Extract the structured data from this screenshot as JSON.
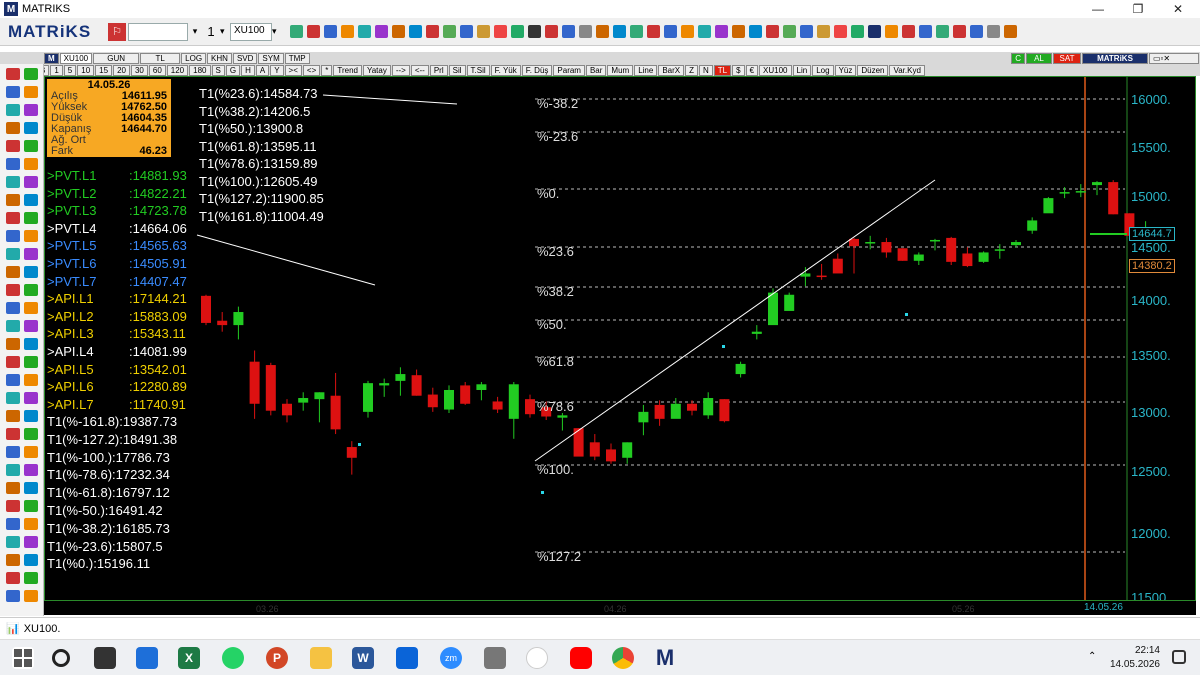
{
  "window": {
    "title": "MATRIKS",
    "brand": "MATRiKS"
  },
  "toolbar": {
    "combo_value": "",
    "count_value": "1",
    "symbol_input": "XU100"
  },
  "strip1": [
    "XU100",
    "GUN",
    "TL",
    "LOG",
    "KHN",
    "SVD",
    "SYM",
    "TMP"
  ],
  "strip1_right": {
    "c": "C",
    "al": "AL",
    "sat": "SAT",
    "brand": "MATRiKS"
  },
  "strip2": [
    "B",
    "1",
    "5",
    "10",
    "15",
    "20",
    "30",
    "60",
    "120",
    "180",
    "S",
    "G",
    "H",
    "A",
    "Y",
    "><",
    "<>",
    "*",
    "Trend",
    "Yatay",
    "-->",
    "<--",
    "Prl",
    "Sil",
    "T.Sil",
    "F. Yük",
    "F. Düş",
    "Param",
    "Bar",
    "Mum",
    "Line",
    "BarX",
    "Z",
    "N",
    "TL",
    "$",
    "€",
    "XU100",
    "Lin",
    "Log",
    "Yüz",
    "Düzen",
    "Var.Kyd"
  ],
  "info": {
    "date": "14.05.26",
    "rows": [
      [
        "Açılış",
        "14611.95"
      ],
      [
        "Yüksek",
        "14762.50"
      ],
      [
        "Düşük",
        "14604.35"
      ],
      [
        "Kapanış",
        "14644.70"
      ],
      [
        "Ağ. Ort",
        ""
      ],
      [
        "Fark",
        "46.23"
      ]
    ]
  },
  "levels": [
    {
      "label": ">PVT.L1",
      "value": ":14881.93",
      "color": "#22cc22"
    },
    {
      "label": ">PVT.L2",
      "value": ":14822.21",
      "color": "#22cc22"
    },
    {
      "label": ">PVT.L3",
      "value": ":14723.78",
      "color": "#22cc22"
    },
    {
      "label": ">PVT.L4",
      "value": ":14664.06",
      "color": "#ffffff"
    },
    {
      "label": ">PVT.L5",
      "value": ":14565.63",
      "color": "#3a8cff"
    },
    {
      "label": ">PVT.L6",
      "value": ":14505.91",
      "color": "#3a8cff"
    },
    {
      "label": ">PVT.L7",
      "value": ":14407.47",
      "color": "#3a8cff"
    },
    {
      "label": ">API.L1",
      "value": ":17144.21",
      "color": "#f0d000"
    },
    {
      "label": ">API.L2",
      "value": ":15883.09",
      "color": "#f0d000"
    },
    {
      "label": ">API.L3",
      "value": ":15343.11",
      "color": "#f0d000"
    },
    {
      "label": ">API.L4",
      "value": ":14081.99",
      "color": "#ffffff"
    },
    {
      "label": ">API.L5",
      "value": ":13542.01",
      "color": "#f0d000"
    },
    {
      "label": ">API.L6",
      "value": ":12280.89",
      "color": "#f0d000"
    },
    {
      "label": ">API.L7",
      "value": ":11740.91",
      "color": "#f0d000"
    }
  ],
  "fib_neg": [
    "T1(%-161.8):19387.73",
    "T1(%-127.2):18491.38",
    "T1(%-100.):17786.73",
    "T1(%-78.6):17232.34",
    "T1(%-61.8):16797.12",
    "T1(%-50.):16491.42",
    "T1(%-38.2):16185.73",
    "T1(%-23.6):15807.5",
    "T1(%0.):15196.11"
  ],
  "fib_pos": [
    "T1(%23.6):14584.73",
    "T1(%38.2):14206.5",
    "T1(%50.):13900.8",
    "T1(%61.8):13595.11",
    "T1(%78.6):13159.89",
    "T1(%100.):12605.49",
    "T1(%127.2):11900.85",
    "T1(%161.8):11004.49"
  ],
  "fib_chart_labels": [
    "%-38.2",
    "%-23.6",
    "%0.",
    "%23.6",
    "%38.2",
    "%50.",
    "%61.8",
    "%78.6",
    "%100.",
    "%127.2"
  ],
  "y_axis": [
    "16000.",
    "15500.",
    "15000.",
    "14500.",
    "14000.",
    "13500.",
    "13000.",
    "12500.",
    "12000.",
    "11500."
  ],
  "price_tags": {
    "last": "14644.7",
    "prev": "14380.2"
  },
  "dates": [
    "03.26",
    "04.26",
    "05.26",
    "14.05.26"
  ],
  "status": {
    "symbol": "XU100."
  },
  "clock": {
    "time": "22:14",
    "date": "14.05.2026"
  },
  "colors": {
    "up": "#22cc22",
    "down": "#dd1111",
    "axis": "#2ab6c8",
    "brand": "#15337a",
    "box": "#f7a823"
  },
  "chart_data": {
    "type": "candlestick",
    "ylim": [
      11500,
      16200
    ],
    "candles": [
      [
        14050,
        14060,
        13780,
        13800
      ],
      [
        13820,
        13900,
        13720,
        13780
      ],
      [
        13780,
        13950,
        13650,
        13900
      ],
      [
        13450,
        13550,
        12950,
        13080
      ],
      [
        13420,
        13440,
        12980,
        13020
      ],
      [
        13080,
        13120,
        12920,
        12980
      ],
      [
        13090,
        13180,
        13020,
        13130
      ],
      [
        13120,
        13180,
        12920,
        13180
      ],
      [
        13150,
        13350,
        12820,
        12860
      ],
      [
        12710,
        12760,
        12480,
        12620
      ],
      [
        13010,
        13280,
        12960,
        13260
      ],
      [
        13240,
        13300,
        13140,
        13260
      ],
      [
        13280,
        13400,
        13150,
        13340
      ],
      [
        13330,
        13380,
        13150,
        13150
      ],
      [
        13160,
        13220,
        13010,
        13050
      ],
      [
        13030,
        13240,
        13000,
        13200
      ],
      [
        13240,
        13270,
        13070,
        13080
      ],
      [
        13200,
        13270,
        13110,
        13250
      ],
      [
        13100,
        13140,
        13000,
        13030
      ],
      [
        12950,
        13270,
        12780,
        13250
      ],
      [
        13120,
        13160,
        12960,
        12990
      ],
      [
        13050,
        13100,
        12940,
        12970
      ],
      [
        12960,
        13000,
        12850,
        12980
      ],
      [
        12870,
        12870,
        12640,
        12630
      ],
      [
        12750,
        12820,
        12600,
        12630
      ],
      [
        12690,
        12740,
        12570,
        12590
      ],
      [
        12620,
        12750,
        12570,
        12750
      ],
      [
        12920,
        13070,
        12810,
        13010
      ],
      [
        13070,
        13110,
        12890,
        12950
      ],
      [
        12950,
        13130,
        12960,
        13080
      ],
      [
        13080,
        13110,
        12980,
        13020
      ],
      [
        12980,
        13180,
        12950,
        13130
      ],
      [
        13120,
        13120,
        12920,
        12930
      ],
      [
        13340,
        13450,
        13310,
        13430
      ],
      [
        13700,
        13780,
        13650,
        13720
      ],
      [
        13780,
        14120,
        13790,
        14080
      ],
      [
        13910,
        14080,
        13920,
        14060
      ],
      [
        14230,
        14320,
        14140,
        14260
      ],
      [
        14240,
        14350,
        14200,
        14230
      ],
      [
        14400,
        14450,
        14310,
        14260
      ],
      [
        14590,
        14600,
        14260,
        14520
      ],
      [
        14560,
        14620,
        14490,
        14560
      ],
      [
        14560,
        14600,
        14410,
        14460
      ],
      [
        14500,
        14500,
        14380,
        14380
      ],
      [
        14380,
        14460,
        14340,
        14440
      ],
      [
        14570,
        14590,
        14480,
        14580
      ],
      [
        14600,
        14610,
        14340,
        14370
      ],
      [
        14450,
        14510,
        14320,
        14330
      ],
      [
        14370,
        14470,
        14360,
        14460
      ],
      [
        14490,
        14540,
        14400,
        14490
      ],
      [
        14530,
        14580,
        14510,
        14560
      ],
      [
        14670,
        14800,
        14640,
        14770
      ],
      [
        14840,
        15000,
        14880,
        14990
      ],
      [
        15040,
        15100,
        14990,
        15050
      ],
      [
        15050,
        15130,
        15000,
        15060
      ],
      [
        15120,
        15160,
        15020,
        15150
      ],
      [
        15150,
        15170,
        14830,
        14830
      ],
      [
        14840,
        14840,
        14590,
        14620
      ],
      [
        14611.95,
        14762.5,
        14604.35,
        14644.7
      ]
    ]
  }
}
